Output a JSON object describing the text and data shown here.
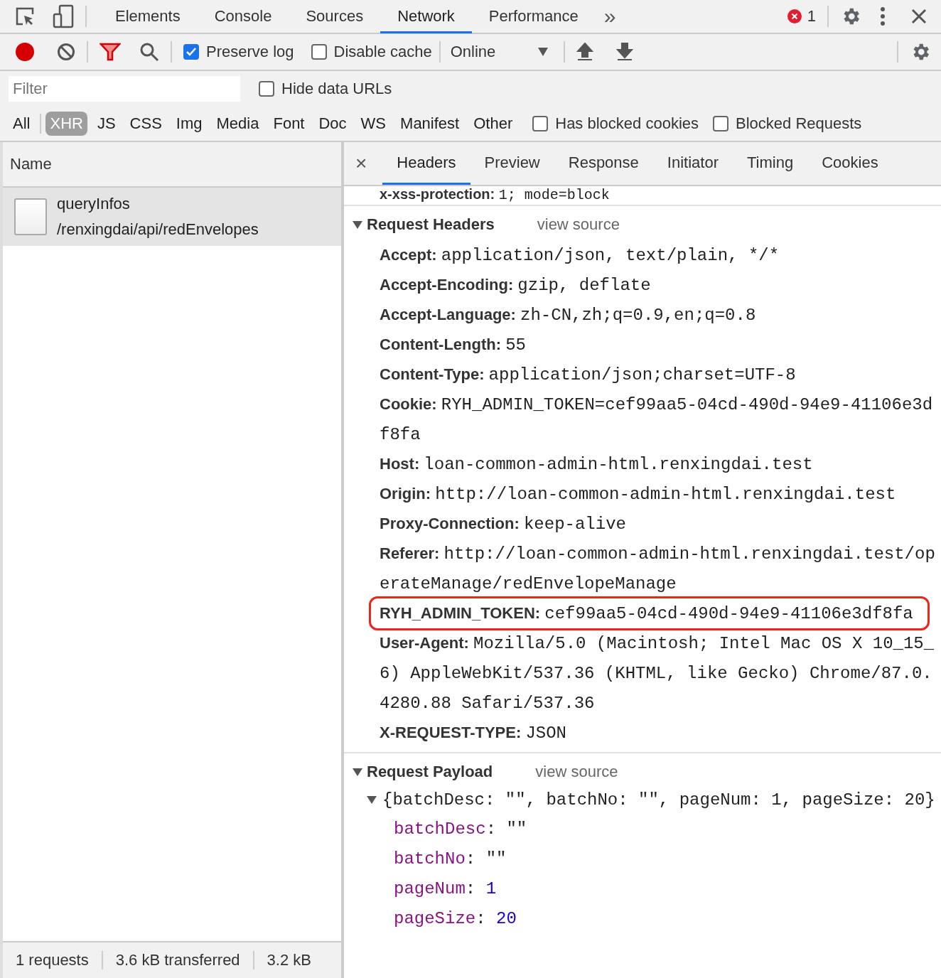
{
  "devtools_tabs": [
    {
      "label": "Elements",
      "selected": false
    },
    {
      "label": "Console",
      "selected": false
    },
    {
      "label": "Sources",
      "selected": false
    },
    {
      "label": "Network",
      "selected": true
    },
    {
      "label": "Performance",
      "selected": false
    }
  ],
  "more_tabs": "»",
  "error_count": "1",
  "toolbar": {
    "recording": true,
    "preserve_log": {
      "label": "Preserve log",
      "checked": true
    },
    "disable_cache": {
      "label": "Disable cache",
      "checked": false
    },
    "throttling": "Online"
  },
  "filter": {
    "placeholder": "Filter"
  },
  "hide_data_urls": {
    "label": "Hide data URLs",
    "checked": false
  },
  "type_filters": [
    {
      "label": "All",
      "selected": false
    },
    {
      "label": "XHR",
      "selected": true
    },
    {
      "label": "JS",
      "selected": false
    },
    {
      "label": "CSS",
      "selected": false
    },
    {
      "label": "Img",
      "selected": false
    },
    {
      "label": "Media",
      "selected": false
    },
    {
      "label": "Font",
      "selected": false
    },
    {
      "label": "Doc",
      "selected": false
    },
    {
      "label": "WS",
      "selected": false
    },
    {
      "label": "Manifest",
      "selected": false
    },
    {
      "label": "Other",
      "selected": false
    }
  ],
  "has_blocked_cookies": {
    "label": "Has blocked cookies",
    "checked": false
  },
  "blocked_requests": {
    "label": "Blocked Requests",
    "checked": false
  },
  "requests": {
    "column": "Name",
    "rows": [
      {
        "name": "queryInfos",
        "path": "/renxingdai/api/redEnvelopes",
        "selected": true
      }
    ]
  },
  "status_bar": [
    "1 requests",
    "3.6 kB transferred",
    "3.2 kB"
  ],
  "detail": {
    "close": "×",
    "tabs": [
      {
        "label": "Headers",
        "selected": true
      },
      {
        "label": "Preview",
        "selected": false
      },
      {
        "label": "Response",
        "selected": false
      },
      {
        "label": "Initiator",
        "selected": false
      },
      {
        "label": "Timing",
        "selected": false
      },
      {
        "label": "Cookies",
        "selected": false
      }
    ],
    "partial_header": {
      "name": "x-xss-protection:",
      "value": "1; mode=block"
    },
    "request_headers": {
      "title": "Request Headers",
      "view_source": "view source",
      "expanded": true,
      "headers": [
        {
          "name": "Accept:",
          "value": "application/json, text/plain, */*",
          "highlighted": false
        },
        {
          "name": "Accept-Encoding:",
          "value": "gzip, deflate",
          "highlighted": false
        },
        {
          "name": "Accept-Language:",
          "value": "zh-CN,zh;q=0.9,en;q=0.8",
          "highlighted": false
        },
        {
          "name": "Content-Length:",
          "value": "55",
          "highlighted": false
        },
        {
          "name": "Content-Type:",
          "value": "application/json;charset=UTF-8",
          "highlighted": false
        },
        {
          "name": "Cookie:",
          "value": "RYH_ADMIN_TOKEN=cef99aa5-04cd-490d-94e9-41106e3df8fa",
          "highlighted": false
        },
        {
          "name": "Host:",
          "value": "loan-common-admin-html.renxingdai.test",
          "highlighted": false
        },
        {
          "name": "Origin:",
          "value": "http://loan-common-admin-html.renxingdai.test",
          "highlighted": false
        },
        {
          "name": "Proxy-Connection:",
          "value": "keep-alive",
          "highlighted": false
        },
        {
          "name": "Referer:",
          "value": "http://loan-common-admin-html.renxingdai.test/operateManage/redEnvelopeManage",
          "highlighted": false
        },
        {
          "name": "RYH_ADMIN_TOKEN:",
          "value": "cef99aa5-04cd-490d-94e9-41106e3df8fa",
          "highlighted": true
        },
        {
          "name": "User-Agent:",
          "value": "Mozilla/5.0 (Macintosh; Intel Mac OS X 10_15_6) AppleWebKit/537.36 (KHTML, like Gecko) Chrome/87.0.4280.88 Safari/537.36",
          "highlighted": false
        },
        {
          "name": "X-REQUEST-TYPE:",
          "value": "JSON",
          "highlighted": false
        }
      ]
    },
    "payload": {
      "title": "Request Payload",
      "view_source": "view source",
      "expanded": true,
      "summary": "{batchDesc: \"\", batchNo: \"\", pageNum: 1, pageSize: 20}",
      "properties": [
        {
          "key": "batchDesc",
          "separator": ":",
          "value": "\"\"",
          "kind": "string"
        },
        {
          "key": "batchNo",
          "separator": ":",
          "value": "\"\"",
          "kind": "string"
        },
        {
          "key": "pageNum",
          "separator": ":",
          "value": "1",
          "kind": "number"
        },
        {
          "key": "pageSize",
          "separator": ":",
          "value": "20",
          "kind": "number"
        }
      ]
    }
  }
}
